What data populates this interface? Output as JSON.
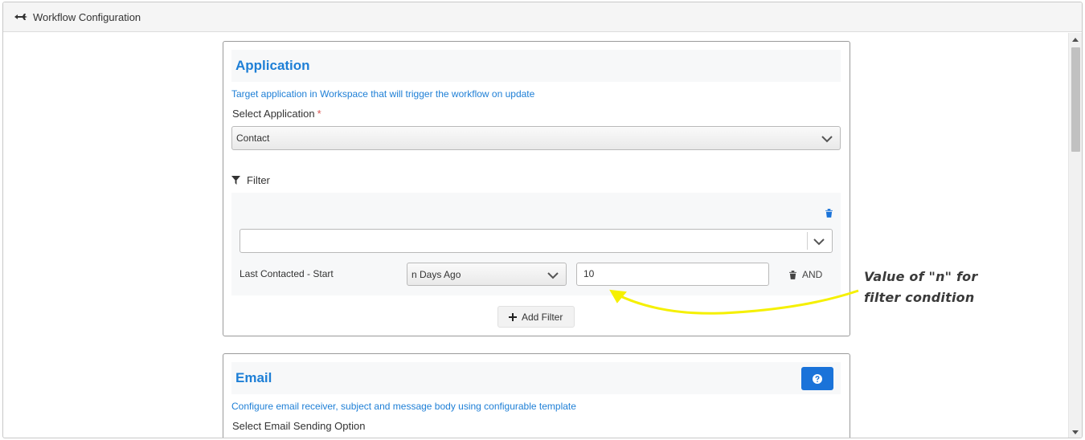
{
  "window": {
    "title": "Workflow Configuration"
  },
  "application_panel": {
    "title": "Application",
    "description": "Target application in Workspace that will trigger the workflow on update",
    "select_label": "Select Application",
    "required_marker": "*",
    "selected_application": "Contact",
    "filter_heading": "Filter",
    "filter_row": {
      "field": "Last Contacted - Start",
      "condition": "n Days Ago",
      "value": "10",
      "logic": "AND"
    },
    "add_filter_label": "Add Filter"
  },
  "email_panel": {
    "title": "Email",
    "description": "Configure email receiver, subject and message body using configurable template",
    "select_label": "Select Email Sending Option"
  },
  "annotation": {
    "line1": "Value of  \"n\" for",
    "line2": "filter condition",
    "color": "#f5f000"
  },
  "colors": {
    "accent": "#1e7fd6",
    "help_button": "#1a73d9",
    "required": "#d9534f"
  },
  "icons": [
    "workflow-icon",
    "filter-icon",
    "trash-icon",
    "plus-icon",
    "question-icon",
    "chevron-down-icon"
  ]
}
